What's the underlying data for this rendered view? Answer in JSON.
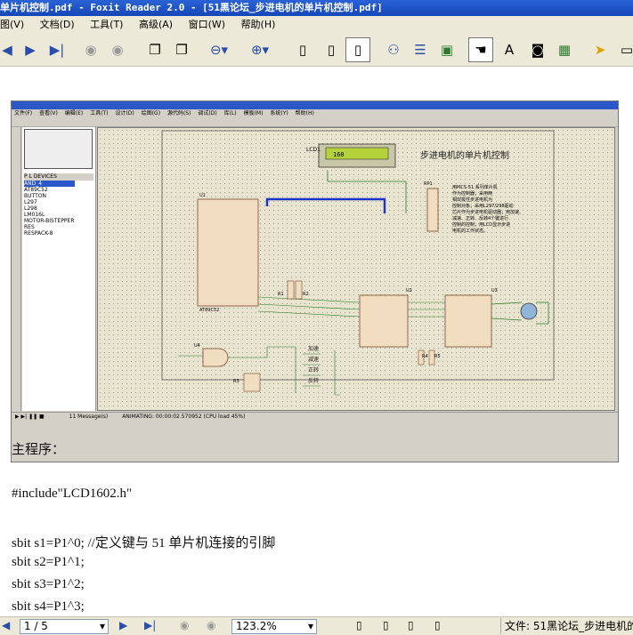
{
  "window": {
    "title": "单片机控制.pdf - Foxit Reader 2.0 - [51黑论坛_步进电机的单片机控制.pdf]"
  },
  "menu": [
    "图(V)",
    "文档(D)",
    "工具(T)",
    "高级(A)",
    "窗口(W)",
    "帮助(H)"
  ],
  "toolbar": {
    "icons": [
      "prev-page-icon",
      "next-page-icon",
      "last-page-icon",
      "back-icon",
      "forward-icon",
      "copy-icon",
      "paste-icon",
      "zoom-out-icon",
      "zoom-in-icon",
      "single-page-icon",
      "continuous-icon",
      "facing-icon",
      "binoculars-icon",
      "text-icon",
      "table-icon",
      "hand-icon",
      "select-text-icon",
      "snapshot-icon",
      "image-icon",
      "arrow-icon"
    ]
  },
  "embedded": {
    "menu": [
      "文件(F)",
      "查看(V)",
      "编辑(E)",
      "工具(T)",
      "设计(D)",
      "绘图(G)",
      "源代码(S)",
      "调试(D)",
      "库(L)",
      "模板(M)",
      "系统(Y)",
      "帮助(H)"
    ],
    "tabs": [
      "P",
      "L",
      "DEVICES"
    ],
    "devices": [
      "AND_4",
      "AT89C52",
      "BUTTON",
      "L297",
      "L298",
      "LM016L",
      "MOTOR-BISTEPPER",
      "RES",
      "RESPACK-8"
    ],
    "schematic_title": "步进电机的单片机控制",
    "lcd_label": "LCD1",
    "lcd_value": "160",
    "rp_label": "RP1",
    "u1_label": "U1",
    "u1_part": "AT89C52",
    "u2_label": "U2",
    "u3_label": "U3",
    "u4_label": "U4",
    "r1_label": "R1",
    "r2_label": "R2",
    "r3_label": "R3",
    "r4_label": "R4",
    "r5_label": "R5",
    "notes": [
      "用MCS-51 系列单片机",
      "作为控制器；采用两",
      "相双极性步进电机为",
      "控制对象；采用L297/298驱动",
      "芯片作为步进电机驱动器；用加速、",
      "减速、正转、反转4个键进行",
      "控制的控制；用LCD显示步进",
      "电机的工作状态。"
    ],
    "buttons": [
      "加速",
      "减速",
      "正转",
      "反转"
    ],
    "status_messages": "11 Message(s)",
    "status_anim": "ANIMATING: 00:00:02.570952 (CPU load 45%)"
  },
  "doc_text": [
    "主程序：",
    "#include\"LCD1602.h\"",
    "sbit s1=P1^0;    //定义键与 51 单片机连接的引脚",
    "sbit s2=P1^1;",
    "sbit s3=P1^2;",
    "sbit s4=P1^3;"
  ],
  "status": {
    "page": "1 / 5",
    "zoom": "123.2%",
    "file_label": "文件: 51黑论坛_步进电机的"
  }
}
